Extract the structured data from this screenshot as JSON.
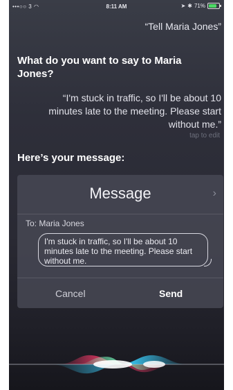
{
  "status_bar": {
    "carrier": "•••○○ 3",
    "time": "8:11 AM",
    "battery": "71%"
  },
  "user_quote": "“Tell Maria Jones”",
  "siri_question": "What do you want to say to Maria Jones?",
  "dictated_quote": "“I'm stuck in traffic, so I'll be about 10 minutes late to the meeting. Please start without me.”",
  "tap_to_edit": "tap to edit",
  "here_message": "Here’s your message:",
  "message_card": {
    "title": "Message",
    "to_line": "To: Maria Jones",
    "body": "I'm stuck in traffic, so I'll be about 10 minutes late to the meeting. Please start without me.",
    "cancel_label": "Cancel",
    "send_label": "Send"
  },
  "icons": [
    "wifi-icon",
    "location-icon",
    "bluetooth-icon",
    "battery-icon",
    "chevron-right-icon",
    "siri-waveform-icon"
  ],
  "colors": {
    "background": "#2e2f3a",
    "card": "#464854",
    "battery_green": "#4cd964"
  }
}
